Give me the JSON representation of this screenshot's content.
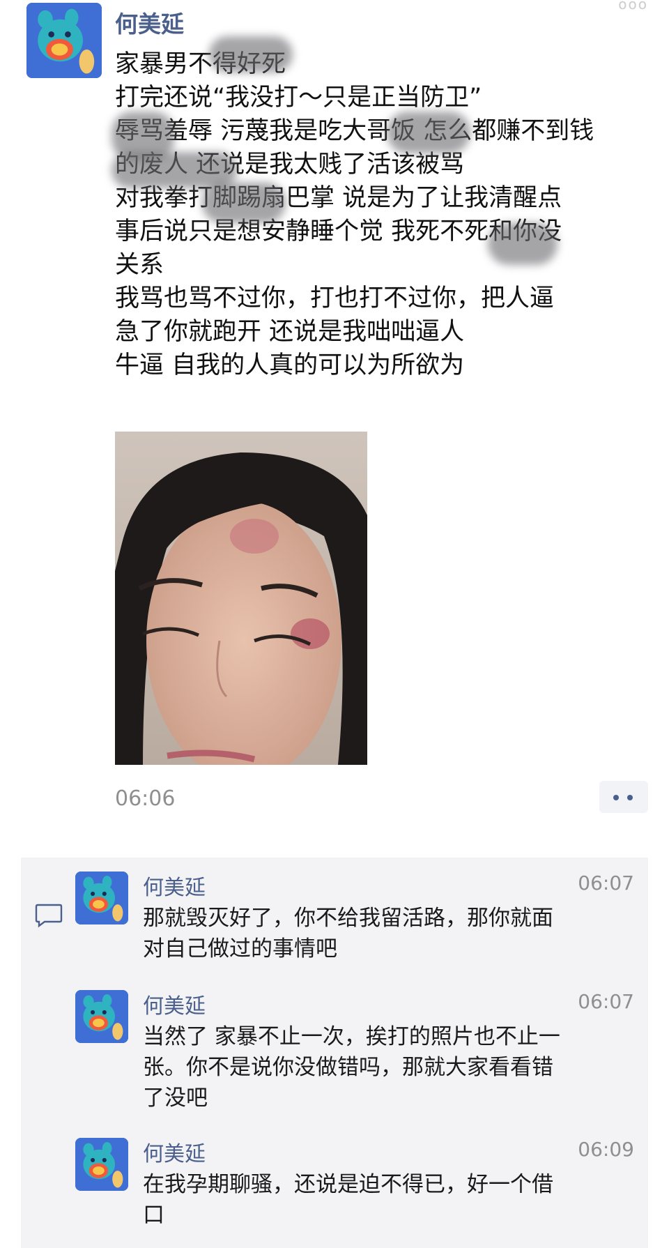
{
  "post": {
    "author": "何美延",
    "text_lines": [
      "家暴男不得好死",
      "打完还说“我没打～只是正当防卫”",
      "辱骂羞辱 污蔑我是吃大哥饭 怎么都赚不到钱",
      "的废人 还说是我太贱了活该被骂",
      "对我拳打脚踢扇巴掌 说是为了让我清醒点",
      "事后说只是想安静睡个觉 我死不死和你没",
      "关系",
      "我骂也骂不过你，打也打不过你，把人逼",
      "急了你就跑开 还说是我咄咄逼人",
      "牛逼 自我的人真的可以为所欲为"
    ],
    "time": "06:06"
  },
  "icons": {
    "avatar": "cartoon-avatar-icon",
    "comment": "comment-bubble-icon",
    "more": "more-dots-icon"
  },
  "comments": [
    {
      "author": "何美延",
      "time": "06:07",
      "lines": [
        "那就毁灭好了，你不给我留活路，那你就面",
        "对自己做过的事情吧"
      ]
    },
    {
      "author": "何美延",
      "time": "06:07",
      "lines": [
        "当然了 家暴不止一次，挨打的照片也不止一",
        "张。你不是说你没做错吗，那就大家看看错",
        "了没吧"
      ]
    },
    {
      "author": "何美延",
      "time": "06:09",
      "lines": [
        "在我孕期聊骚，还说是迫不得已，好一个借",
        "口"
      ]
    }
  ],
  "colors": {
    "name": "#4a5f8c",
    "avatar_bg": "#3f6fd4",
    "comment_bg": "#f3f3f5",
    "time": "#8f8f8f"
  }
}
